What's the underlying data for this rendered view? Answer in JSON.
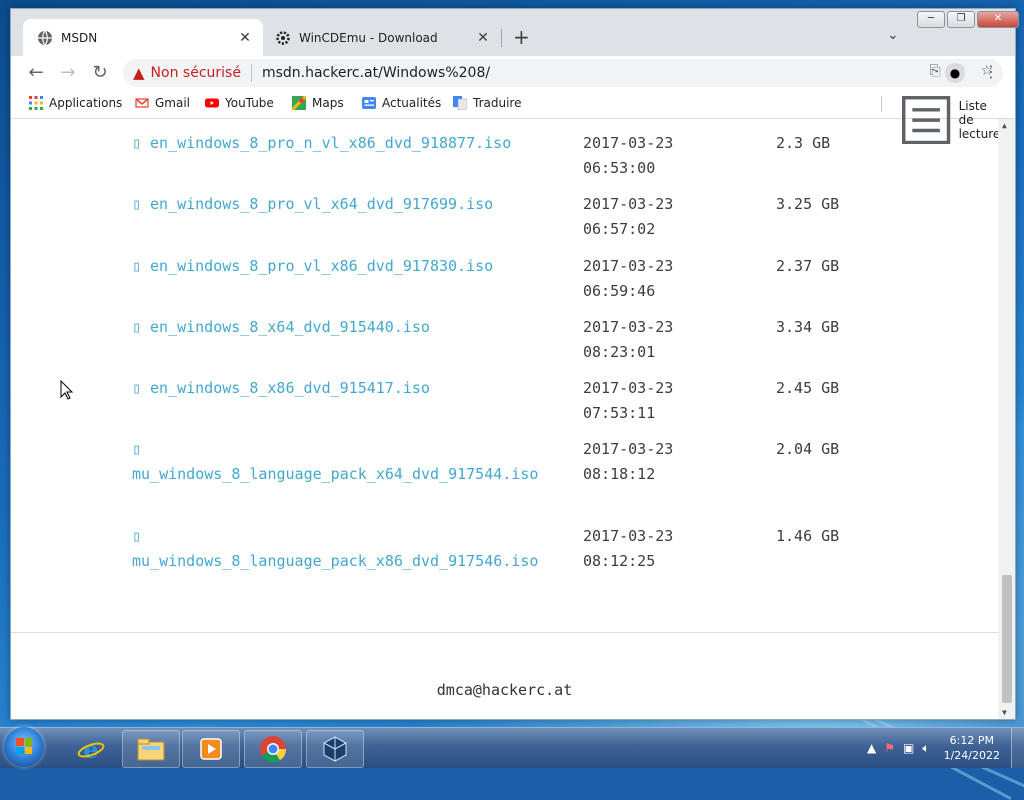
{
  "window": {
    "tabs": [
      {
        "title": "MSDN",
        "icon": "globe-icon",
        "active": true
      },
      {
        "title": "WinCDEmu - Download",
        "icon": "gear-icon",
        "active": false
      }
    ],
    "new_tab": "+",
    "tab_list": "⌄",
    "controls": [
      "─",
      "❐",
      "✕"
    ]
  },
  "toolbar": {
    "back": "←",
    "forward": "→",
    "reload": "↻",
    "security_label": "Non sécurisé",
    "url": "msdn.hackerc.at/Windows%208/"
  },
  "bookmarks": {
    "items": [
      {
        "label": "Applications",
        "icon": "apps-grid-icon"
      },
      {
        "label": "Gmail",
        "icon": "gmail-icon"
      },
      {
        "label": "YouTube",
        "icon": "youtube-icon"
      },
      {
        "label": "Maps",
        "icon": "maps-icon"
      },
      {
        "label": "Actualités",
        "icon": "news-icon"
      },
      {
        "label": "Traduire",
        "icon": "translate-icon"
      }
    ],
    "reading_list": "Liste de lecture"
  },
  "files": [
    {
      "name": "en_windows_8_pro_n_vl_x86_dvd_918877.iso",
      "date": "2017-03-23",
      "time": "06:53:00",
      "size": "2.3 GB"
    },
    {
      "name": "en_windows_8_pro_vl_x64_dvd_917699.iso",
      "date": "2017-03-23",
      "time": "06:57:02",
      "size": "3.25 GB"
    },
    {
      "name": "en_windows_8_pro_vl_x86_dvd_917830.iso",
      "date": "2017-03-23",
      "time": "06:59:46",
      "size": "2.37 GB"
    },
    {
      "name": "en_windows_8_x64_dvd_915440.iso",
      "date": "2017-03-23",
      "time": "08:23:01",
      "size": "3.34 GB"
    },
    {
      "name": "en_windows_8_x86_dvd_915417.iso",
      "date": "2017-03-23",
      "time": "07:53:11",
      "size": "2.45 GB"
    },
    {
      "name": "mu_windows_8_language_pack_x64_dvd_917544.iso",
      "date": "2017-03-23",
      "time": "08:18:12",
      "size": "2.04 GB"
    },
    {
      "name": "mu_windows_8_language_pack_x86_dvd_917546.iso",
      "date": "2017-03-23",
      "time": "08:12:25",
      "size": "1.46 GB"
    }
  ],
  "footer": {
    "email": "dmca@hackerc.at"
  },
  "taskbar": {
    "apps": [
      "internet-explorer-icon",
      "file-explorer-icon",
      "media-player-icon",
      "chrome-icon",
      "virtualbox-icon"
    ],
    "time": "6:12 PM",
    "date": "1/24/2022"
  }
}
